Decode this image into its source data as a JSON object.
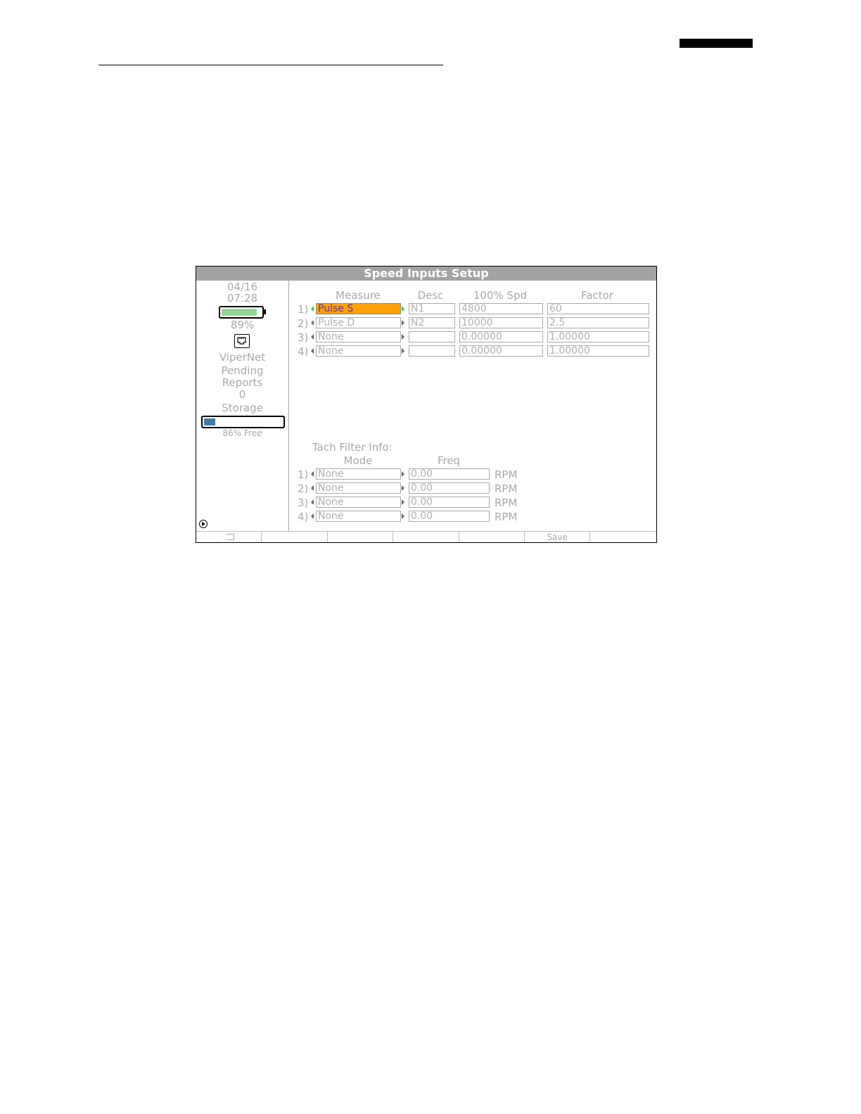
{
  "title": "Speed Inputs Setup",
  "status": {
    "date": "04/16",
    "time": "07:28",
    "battery_percent_label": "89%",
    "battery_level": 0.89,
    "network_icon": "ethernet-port-icon",
    "network_name": "ViperNet",
    "pending_label_1": "Pending",
    "pending_label_2": "Reports",
    "pending_count": "0",
    "storage_label": "Storage",
    "storage_free_label": "86% Free",
    "storage_used_fraction": 0.14
  },
  "speed_inputs": {
    "headers": {
      "measure": "Measure",
      "desc": "Desc",
      "spd": "100% Spd",
      "factor": "Factor"
    },
    "rows": [
      {
        "index": "1)",
        "measure": "Pulse S",
        "desc": "N1",
        "spd": "4800",
        "factor": "60"
      },
      {
        "index": "2)",
        "measure": "Pulse D",
        "desc": "N2",
        "spd": "10000",
        "factor": "2.5"
      },
      {
        "index": "3)",
        "measure": "None",
        "desc": "",
        "spd": "0.00000",
        "factor": "1.00000"
      },
      {
        "index": "4)",
        "measure": "None",
        "desc": "",
        "spd": "0.00000",
        "factor": "1.00000"
      }
    ]
  },
  "tach_filter": {
    "label": "Tach Filter Info:",
    "headers": {
      "mode": "Mode",
      "freq": "Freq"
    },
    "rows": [
      {
        "index": "1)",
        "mode": "None",
        "freq": "0.00",
        "unit": "RPM"
      },
      {
        "index": "2)",
        "mode": "None",
        "freq": "0.00",
        "unit": "RPM"
      },
      {
        "index": "3)",
        "mode": "None",
        "freq": "0.00",
        "unit": "RPM"
      },
      {
        "index": "4)",
        "mode": "None",
        "freq": "0.00",
        "unit": "RPM"
      }
    ]
  },
  "softkeys": {
    "key1_icon": "backspace-icon",
    "key6_label": "Save"
  },
  "colors": {
    "selected_field": "#ffa200",
    "selected_text": "#6b2fa0",
    "active_arrow": "#2fc32f",
    "battery_fill": "#90d890",
    "storage_fill": "#3f7aa6",
    "titlebar": "#a3a3a3"
  }
}
